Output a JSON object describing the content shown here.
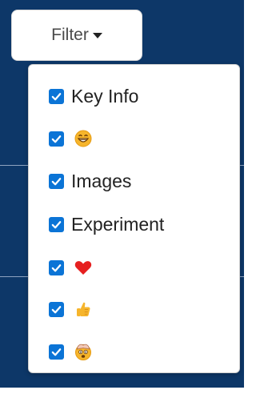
{
  "filter_button": {
    "label": "Filter",
    "caret_icon": "caret-down-icon"
  },
  "menu": {
    "items": [
      {
        "label": "Key Info",
        "checked": true
      },
      {
        "icon": "grinning-face-icon",
        "checked": true
      },
      {
        "label": "Images",
        "checked": true
      },
      {
        "label": "Experiment",
        "checked": true
      },
      {
        "icon": "red-heart-icon",
        "checked": true
      },
      {
        "icon": "thumbs-up-icon",
        "checked": true
      },
      {
        "icon": "mind-blown-face-icon",
        "checked": true
      }
    ]
  },
  "colors": {
    "background": "#0d3768",
    "checkbox": "#0b74d6",
    "heart": "#e62020",
    "emoji_yellow": "#f6b52c"
  }
}
